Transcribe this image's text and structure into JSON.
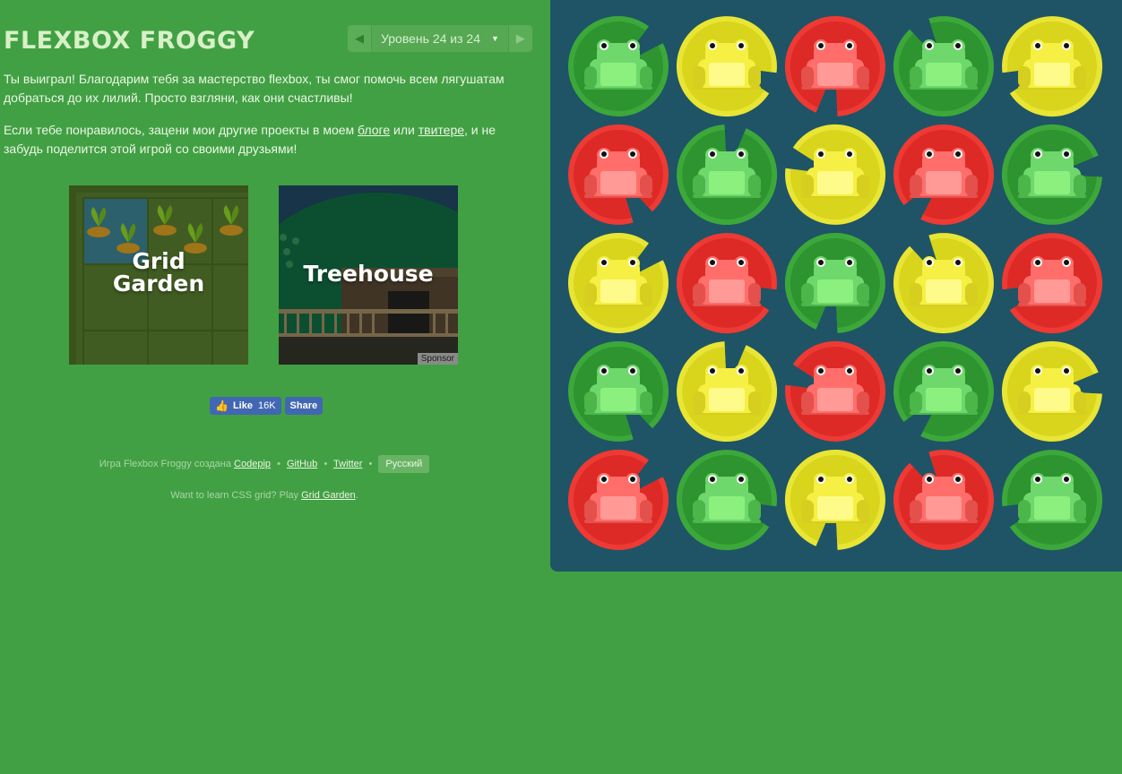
{
  "game": {
    "title": "FLEXBOX FROGGY",
    "level_label": "Уровень 24 из 24",
    "prev_icon": "◀",
    "next_icon": "▶",
    "dropdown_icon": "▼"
  },
  "message": {
    "p1": "Ты выиграл! Благодарим тебя за мастерство flexbox, ты смог помочь всем лягушатам добраться до их лилий. Просто взгляни, как они счастливы!",
    "p2_before": "Если тебе понравилось, зацени мои другие проекты в моем ",
    "p2_link1": "блоге",
    "p2_middle": " или ",
    "p2_link2": "твитере",
    "p2_after": ", и не забудь поделится этой игрой со своими друзьями!"
  },
  "promos": {
    "grid_line1": "Grid",
    "grid_line2": "Garden",
    "treehouse": "Treehouse",
    "sponsor": "Sponsor"
  },
  "social": {
    "like_label": "Like",
    "like_count": "16K",
    "share_label": "Share",
    "like_icon": "thumbs-up-icon"
  },
  "footer": {
    "credit_text": "Игра Flexbox Froggy создана ",
    "codepip": "Codepip",
    "sep": "•",
    "github": "GitHub",
    "twitter": "Twitter",
    "language": "Русский",
    "grid_text": "Want to learn CSS grid? Play ",
    "grid_link": "Grid Garden",
    "grid_end": "."
  },
  "colors": {
    "background": "#42a044",
    "pond": "#1e5466",
    "green_pad": "#2e9430",
    "green_frog": "#6fd86c",
    "yellow_pad": "#d8d51c",
    "yellow_frog": "#f5f043",
    "red_pad": "#dd2a26",
    "red_frog": "#ff6e6a"
  },
  "pond": {
    "rows": [
      [
        "green",
        "yellow",
        "red",
        "green",
        "yellow"
      ],
      [
        "red",
        "green",
        "yellow",
        "red",
        "green"
      ],
      [
        "yellow",
        "red",
        "green",
        "yellow",
        "red"
      ],
      [
        "green",
        "yellow",
        "red",
        "green",
        "yellow"
      ],
      [
        "red",
        "green",
        "yellow",
        "red",
        "green"
      ]
    ]
  }
}
